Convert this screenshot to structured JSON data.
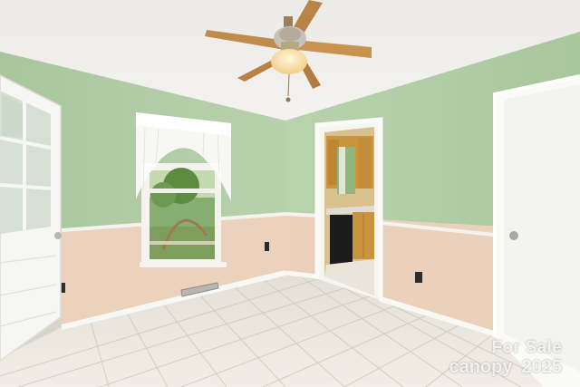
{
  "watermark": {
    "line1": "For Sale",
    "brand": "canopy",
    "year": "2025"
  },
  "colors": {
    "ceiling": "#f1f0ec",
    "wall_green": "#b3cfaa",
    "wainscot": "#ecd2bd",
    "trim": "#f7f7f3",
    "floor_tile": "#ece8e1",
    "door_white": "#f6f6f4"
  }
}
